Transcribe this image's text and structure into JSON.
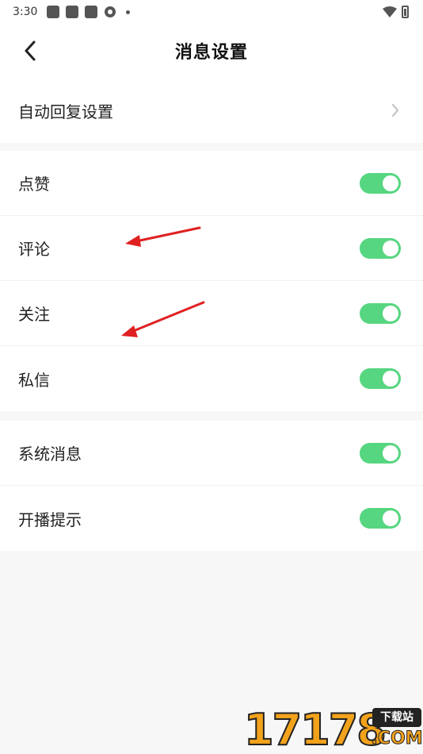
{
  "status_bar": {
    "time": "3:30"
  },
  "header": {
    "title": "消息设置"
  },
  "sections": [
    {
      "items": [
        {
          "label": "自动回复设置",
          "type": "link"
        }
      ]
    },
    {
      "items": [
        {
          "label": "点赞",
          "type": "toggle",
          "on": true
        },
        {
          "label": "评论",
          "type": "toggle",
          "on": true
        },
        {
          "label": "关注",
          "type": "toggle",
          "on": true
        },
        {
          "label": "私信",
          "type": "toggle",
          "on": true
        }
      ]
    },
    {
      "items": [
        {
          "label": "系统消息",
          "type": "toggle",
          "on": true
        },
        {
          "label": "开播提示",
          "type": "toggle",
          "on": true
        }
      ]
    }
  ],
  "watermark": {
    "numbers": "17178",
    "badge": "下载站",
    "suffix": ".COM"
  },
  "colors": {
    "toggle_on": "#56d680",
    "background": "#f7f7f7",
    "annotation": "#e02020"
  }
}
